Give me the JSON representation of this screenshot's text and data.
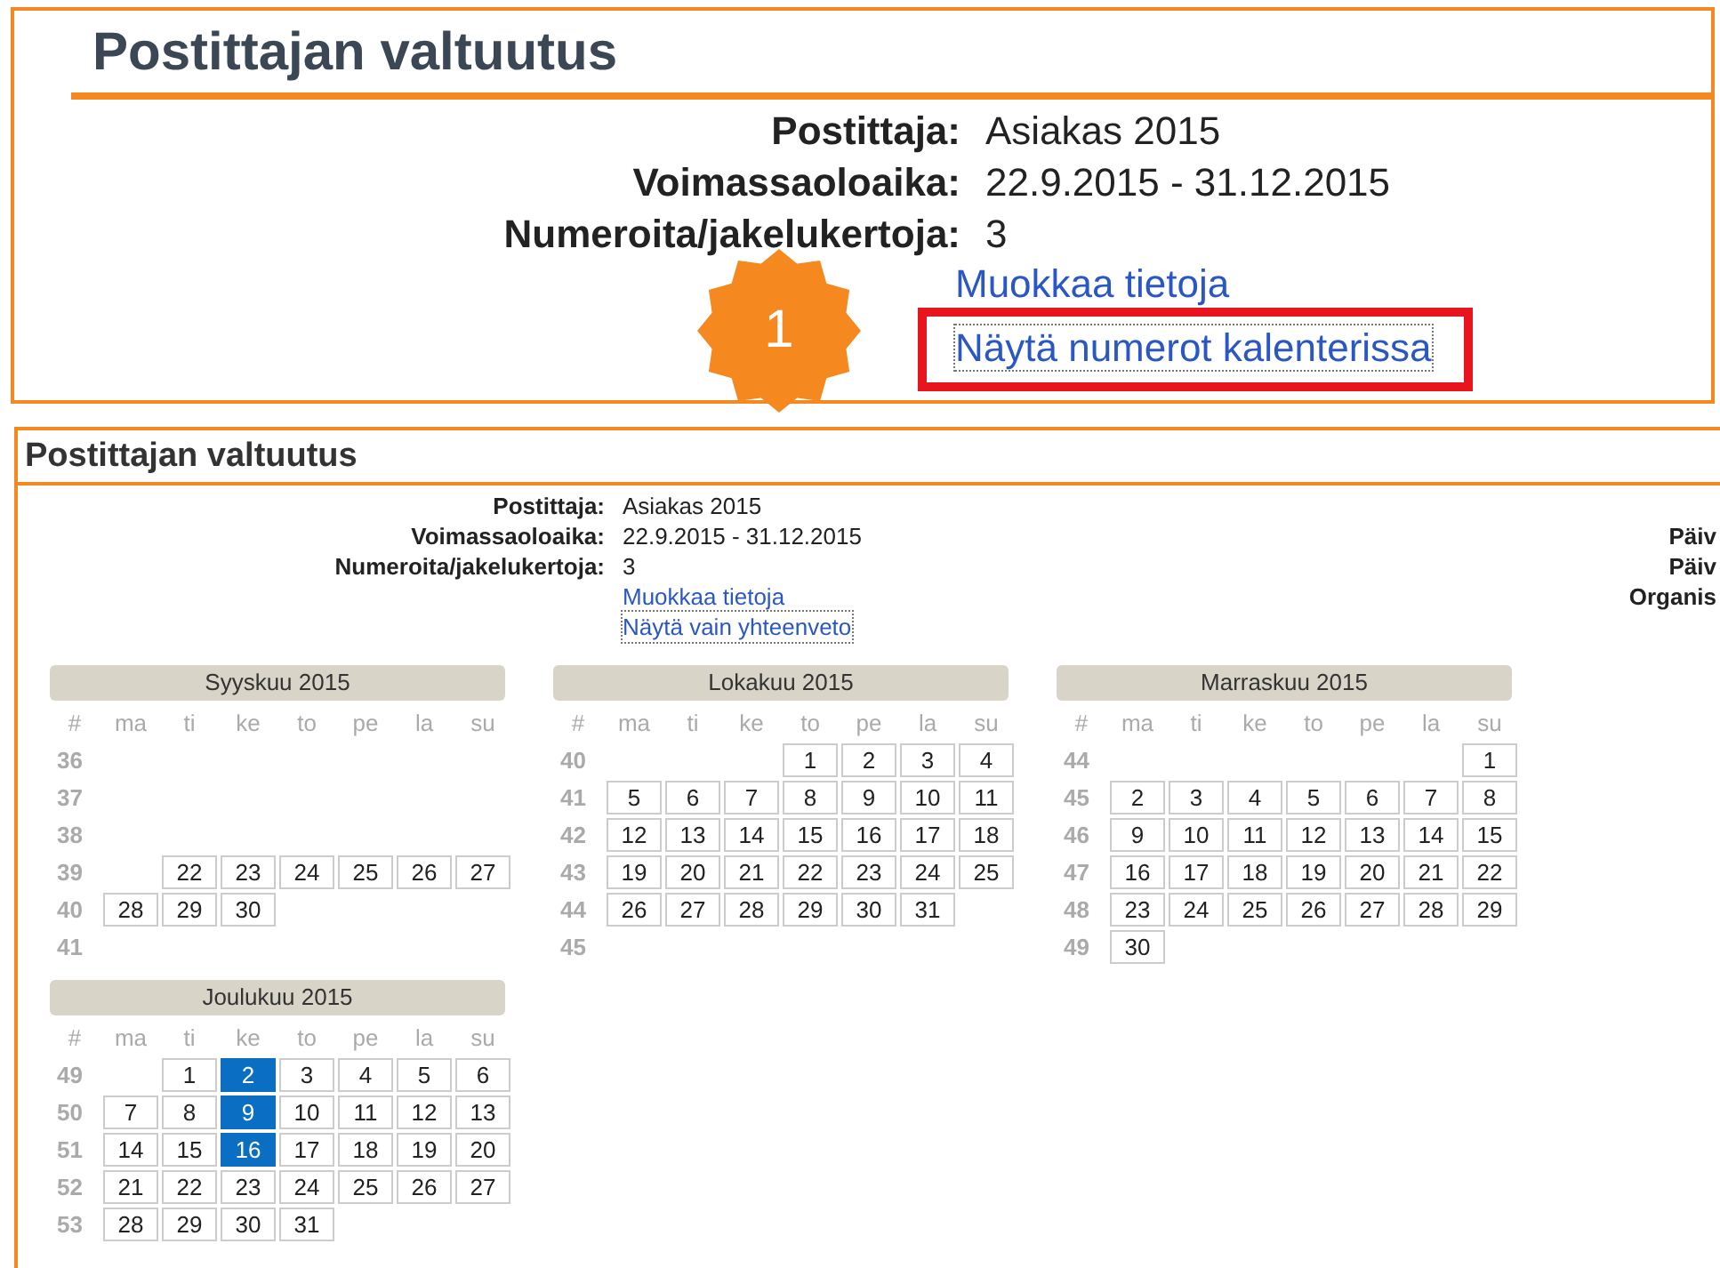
{
  "zoom_panel": {
    "title": "Postittajan valtuutus",
    "fields": [
      {
        "label": "Postittaja:",
        "value": "Asiakas 2015"
      },
      {
        "label": "Voimassaoloaika:",
        "value": "22.9.2015 - 31.12.2015"
      },
      {
        "label": "Numeroita/jakelukertoja:",
        "value": "3"
      }
    ],
    "links": [
      {
        "text": "Muokkaa tietoja",
        "highlighted": false,
        "focused": false
      },
      {
        "text": "Näytä numerot kalenterissa",
        "highlighted": true,
        "focused": true
      }
    ],
    "step_badge": "1"
  },
  "page": {
    "title": "Postittajan valtuutus",
    "fields": [
      {
        "label": "Postittaja:",
        "value": "Asiakas 2015"
      },
      {
        "label": "Voimassaoloaika:",
        "value": "22.9.2015 - 31.12.2015"
      },
      {
        "label": "Numeroita/jakelukertoja:",
        "value": "3"
      }
    ],
    "links": [
      {
        "text": "Muokkaa tietoja",
        "focused": false
      },
      {
        "text": "Näytä vain yhteenveto",
        "focused": true
      }
    ],
    "side_labels": [
      "Päiv",
      "Päiv",
      "Organis"
    ],
    "calendars": [
      {
        "title": "Syyskuu 2015",
        "weekdays": [
          "#",
          "ma",
          "ti",
          "ke",
          "to",
          "pe",
          "la",
          "su"
        ],
        "weeks": [
          {
            "week": "36"
          },
          {
            "week": "37"
          },
          {
            "week": "38"
          },
          {
            "week": "39",
            "days": [
              {
                "kind": "empty"
              },
              {
                "kind": "date",
                "day": "22",
                "selected": false
              },
              {
                "kind": "date",
                "day": "23",
                "selected": false
              },
              {
                "kind": "date",
                "day": "24",
                "selected": false
              },
              {
                "kind": "date",
                "day": "25",
                "selected": false
              },
              {
                "kind": "date",
                "day": "26",
                "selected": false
              },
              {
                "kind": "date",
                "day": "27",
                "selected": false
              }
            ]
          },
          {
            "week": "40",
            "days": [
              {
                "kind": "date",
                "day": "28",
                "selected": false
              },
              {
                "kind": "date",
                "day": "29",
                "selected": false
              },
              {
                "kind": "date",
                "day": "30",
                "selected": false
              }
            ]
          },
          {
            "week": "41"
          }
        ]
      },
      {
        "title": "Lokakuu 2015",
        "weekdays": [
          "#",
          "ma",
          "ti",
          "ke",
          "to",
          "pe",
          "la",
          "su"
        ],
        "weeks": [
          {
            "week": "40",
            "days": [
              {
                "kind": "empty"
              },
              {
                "kind": "empty"
              },
              {
                "kind": "empty"
              },
              {
                "kind": "date",
                "day": "1",
                "selected": false
              },
              {
                "kind": "date",
                "day": "2",
                "selected": false
              },
              {
                "kind": "date",
                "day": "3",
                "selected": false
              },
              {
                "kind": "date",
                "day": "4",
                "selected": false
              }
            ]
          },
          {
            "week": "41",
            "days": [
              {
                "kind": "date",
                "day": "5",
                "selected": false
              },
              {
                "kind": "date",
                "day": "6",
                "selected": false
              },
              {
                "kind": "date",
                "day": "7",
                "selected": false
              },
              {
                "kind": "date",
                "day": "8",
                "selected": false
              },
              {
                "kind": "date",
                "day": "9",
                "selected": false
              },
              {
                "kind": "date",
                "day": "10",
                "selected": false
              },
              {
                "kind": "date",
                "day": "11",
                "selected": false
              }
            ]
          },
          {
            "week": "42",
            "days": [
              {
                "kind": "date",
                "day": "12",
                "selected": false
              },
              {
                "kind": "date",
                "day": "13",
                "selected": false
              },
              {
                "kind": "date",
                "day": "14",
                "selected": false
              },
              {
                "kind": "date",
                "day": "15",
                "selected": false
              },
              {
                "kind": "date",
                "day": "16",
                "selected": false
              },
              {
                "kind": "date",
                "day": "17",
                "selected": false
              },
              {
                "kind": "date",
                "day": "18",
                "selected": false
              }
            ]
          },
          {
            "week": "43",
            "days": [
              {
                "kind": "date",
                "day": "19",
                "selected": false
              },
              {
                "kind": "date",
                "day": "20",
                "selected": false
              },
              {
                "kind": "date",
                "day": "21",
                "selected": false
              },
              {
                "kind": "date",
                "day": "22",
                "selected": false
              },
              {
                "kind": "date",
                "day": "23",
                "selected": false
              },
              {
                "kind": "date",
                "day": "24",
                "selected": false
              },
              {
                "kind": "date",
                "day": "25",
                "selected": false
              }
            ]
          },
          {
            "week": "44",
            "days": [
              {
                "kind": "date",
                "day": "26",
                "selected": false
              },
              {
                "kind": "date",
                "day": "27",
                "selected": false
              },
              {
                "kind": "date",
                "day": "28",
                "selected": false
              },
              {
                "kind": "date",
                "day": "29",
                "selected": false
              },
              {
                "kind": "date",
                "day": "30",
                "selected": false
              },
              {
                "kind": "date",
                "day": "31",
                "selected": false
              }
            ]
          },
          {
            "week": "45"
          }
        ]
      },
      {
        "title": "Marraskuu 2015",
        "weekdays": [
          "#",
          "ma",
          "ti",
          "ke",
          "to",
          "pe",
          "la",
          "su"
        ],
        "weeks": [
          {
            "week": "44",
            "days": [
              {
                "kind": "empty"
              },
              {
                "kind": "empty"
              },
              {
                "kind": "empty"
              },
              {
                "kind": "empty"
              },
              {
                "kind": "empty"
              },
              {
                "kind": "empty"
              },
              {
                "kind": "date",
                "day": "1",
                "selected": false
              }
            ]
          },
          {
            "week": "45",
            "days": [
              {
                "kind": "date",
                "day": "2",
                "selected": false
              },
              {
                "kind": "date",
                "day": "3",
                "selected": false
              },
              {
                "kind": "date",
                "day": "4",
                "selected": false
              },
              {
                "kind": "date",
                "day": "5",
                "selected": false
              },
              {
                "kind": "date",
                "day": "6",
                "selected": false
              },
              {
                "kind": "date",
                "day": "7",
                "selected": false
              },
              {
                "kind": "date",
                "day": "8",
                "selected": false
              }
            ]
          },
          {
            "week": "46",
            "days": [
              {
                "kind": "date",
                "day": "9",
                "selected": false
              },
              {
                "kind": "date",
                "day": "10",
                "selected": false
              },
              {
                "kind": "date",
                "day": "11",
                "selected": false
              },
              {
                "kind": "date",
                "day": "12",
                "selected": false
              },
              {
                "kind": "date",
                "day": "13",
                "selected": false
              },
              {
                "kind": "date",
                "day": "14",
                "selected": false
              },
              {
                "kind": "date",
                "day": "15",
                "selected": false
              }
            ]
          },
          {
            "week": "47",
            "days": [
              {
                "kind": "date",
                "day": "16",
                "selected": false
              },
              {
                "kind": "date",
                "day": "17",
                "selected": false
              },
              {
                "kind": "date",
                "day": "18",
                "selected": false
              },
              {
                "kind": "date",
                "day": "19",
                "selected": false
              },
              {
                "kind": "date",
                "day": "20",
                "selected": false
              },
              {
                "kind": "date",
                "day": "21",
                "selected": false
              },
              {
                "kind": "date",
                "day": "22",
                "selected": false
              }
            ]
          },
          {
            "week": "48",
            "days": [
              {
                "kind": "date",
                "day": "23",
                "selected": false
              },
              {
                "kind": "date",
                "day": "24",
                "selected": false
              },
              {
                "kind": "date",
                "day": "25",
                "selected": false
              },
              {
                "kind": "date",
                "day": "26",
                "selected": false
              },
              {
                "kind": "date",
                "day": "27",
                "selected": false
              },
              {
                "kind": "date",
                "day": "28",
                "selected": false
              },
              {
                "kind": "date",
                "day": "29",
                "selected": false
              }
            ]
          },
          {
            "week": "49",
            "days": [
              {
                "kind": "date",
                "day": "30",
                "selected": false
              }
            ]
          }
        ]
      },
      {
        "title": "Joulukuu 2015",
        "weekdays": [
          "#",
          "ma",
          "ti",
          "ke",
          "to",
          "pe",
          "la",
          "su"
        ],
        "weeks": [
          {
            "week": "49",
            "days": [
              {
                "kind": "empty"
              },
              {
                "kind": "date",
                "day": "1",
                "selected": false
              },
              {
                "kind": "date",
                "day": "2",
                "selected": true
              },
              {
                "kind": "date",
                "day": "3",
                "selected": false
              },
              {
                "kind": "date",
                "day": "4",
                "selected": false
              },
              {
                "kind": "date",
                "day": "5",
                "selected": false
              },
              {
                "kind": "date",
                "day": "6",
                "selected": false
              }
            ]
          },
          {
            "week": "50",
            "days": [
              {
                "kind": "date",
                "day": "7",
                "selected": false
              },
              {
                "kind": "date",
                "day": "8",
                "selected": false
              },
              {
                "kind": "date",
                "day": "9",
                "selected": true
              },
              {
                "kind": "date",
                "day": "10",
                "selected": false
              },
              {
                "kind": "date",
                "day": "11",
                "selected": false
              },
              {
                "kind": "date",
                "day": "12",
                "selected": false
              },
              {
                "kind": "date",
                "day": "13",
                "selected": false
              }
            ]
          },
          {
            "week": "51",
            "days": [
              {
                "kind": "date",
                "day": "14",
                "selected": false
              },
              {
                "kind": "date",
                "day": "15",
                "selected": false
              },
              {
                "kind": "date",
                "day": "16",
                "selected": true
              },
              {
                "kind": "date",
                "day": "17",
                "selected": false
              },
              {
                "kind": "date",
                "day": "18",
                "selected": false
              },
              {
                "kind": "date",
                "day": "19",
                "selected": false
              },
              {
                "kind": "date",
                "day": "20",
                "selected": false
              }
            ]
          },
          {
            "week": "52",
            "days": [
              {
                "kind": "date",
                "day": "21",
                "selected": false
              },
              {
                "kind": "date",
                "day": "22",
                "selected": false
              },
              {
                "kind": "date",
                "day": "23",
                "selected": false
              },
              {
                "kind": "date",
                "day": "24",
                "selected": false
              },
              {
                "kind": "date",
                "day": "25",
                "selected": false
              },
              {
                "kind": "date",
                "day": "26",
                "selected": false
              },
              {
                "kind": "date",
                "day": "27",
                "selected": false
              }
            ]
          },
          {
            "week": "53",
            "days": [
              {
                "kind": "date",
                "day": "28",
                "selected": false
              },
              {
                "kind": "date",
                "day": "29",
                "selected": false
              },
              {
                "kind": "date",
                "day": "30",
                "selected": false
              },
              {
                "kind": "date",
                "day": "31",
                "selected": false
              }
            ]
          }
        ]
      }
    ]
  }
}
